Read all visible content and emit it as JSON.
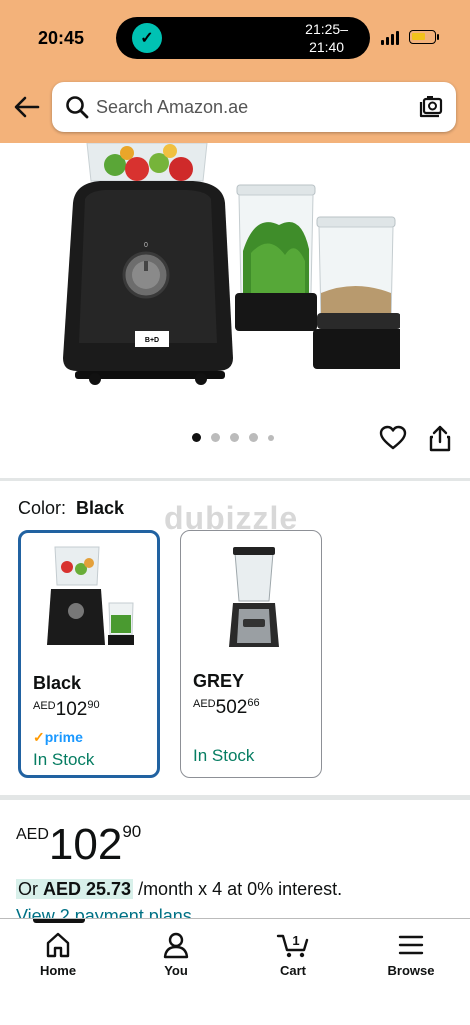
{
  "status_bar": {
    "time": "20:45",
    "live_activity": {
      "line1": "21:25–",
      "line2": "21:40"
    }
  },
  "search": {
    "placeholder": "Search Amazon.ae"
  },
  "gallery": {
    "image_count": 5,
    "active_index": 0
  },
  "color_selector": {
    "label": "Color:",
    "selected": "Black",
    "options": [
      {
        "name": "Black",
        "currency": "AED",
        "price_whole": "102",
        "price_fraction": "90",
        "prime": "prime",
        "stock": "In Stock"
      },
      {
        "name": "GREY",
        "currency": "AED",
        "price_whole": "502",
        "price_fraction": "66",
        "stock": "In Stock"
      }
    ]
  },
  "watermark": "dubizzle",
  "price": {
    "currency": "AED",
    "whole": "102",
    "fraction": "90"
  },
  "installment": {
    "prefix": "Or ",
    "amount": "AED 25.73",
    "suffix": " /month x 4 at 0% interest."
  },
  "payment_plans_link": "View 2 payment plans",
  "tab_bar": {
    "tabs": [
      {
        "label": "Home",
        "active": true
      },
      {
        "label": "You"
      },
      {
        "label": "Cart",
        "badge": "1"
      },
      {
        "label": "Browse"
      }
    ]
  },
  "colors": {
    "header": "#f3b27a",
    "selected_border": "#2162a1",
    "in_stock": "#067d62",
    "link": "#007185",
    "prime": "#1a98ff"
  }
}
